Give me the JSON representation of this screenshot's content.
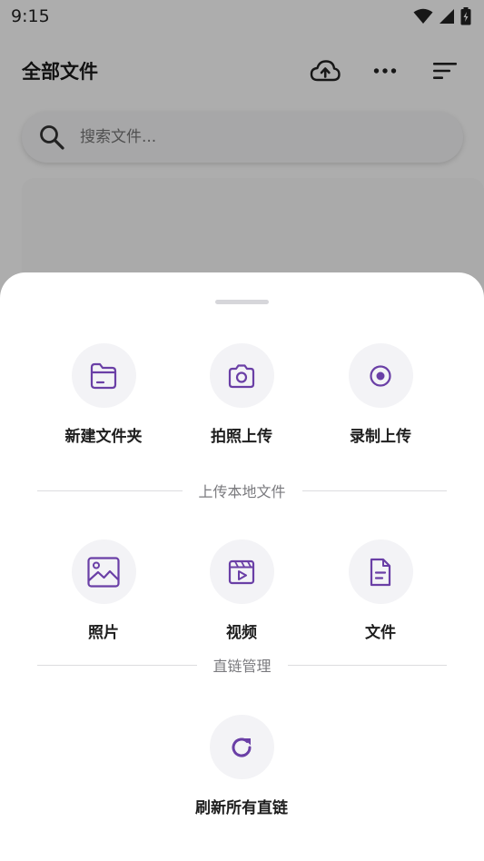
{
  "status_bar": {
    "time": "9:15"
  },
  "header": {
    "title": "全部文件"
  },
  "search": {
    "placeholder": "搜索文件..."
  },
  "sheet": {
    "quick_actions": [
      {
        "label": "新建文件夹",
        "icon": "folder-icon"
      },
      {
        "label": "拍照上传",
        "icon": "camera-icon"
      },
      {
        "label": "录制上传",
        "icon": "record-icon"
      }
    ],
    "local_section": {
      "title": "上传本地文件",
      "items": [
        {
          "label": "照片",
          "icon": "image-icon"
        },
        {
          "label": "视频",
          "icon": "video-icon"
        },
        {
          "label": "文件",
          "icon": "file-icon"
        }
      ]
    },
    "link_section": {
      "title": "直链管理",
      "items": [
        {
          "label": "刷新所有直链",
          "icon": "refresh-icon"
        }
      ]
    }
  },
  "colors": {
    "accent": "#6a3fa6",
    "scrim": "#000000",
    "icon_bg": "#f3f3f6"
  }
}
